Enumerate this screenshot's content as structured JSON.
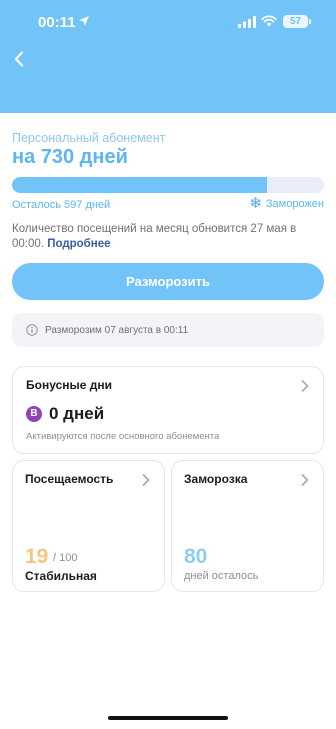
{
  "colors": {
    "accent": "#72c3f7",
    "accent_text": "#5eb5f0",
    "link": "#3b5da6",
    "bonus_badge": "#8f44b4",
    "attendance_value": "#f3c681",
    "freeze_value": "#8fcdf3"
  },
  "status_bar": {
    "time": "00:11",
    "battery": "57"
  },
  "subscription": {
    "label": "Персональный абонемент",
    "title": "на 730 дней",
    "progress_fraction": 0.818,
    "remaining": "Осталось 597 дней",
    "frozen_label": "Заморожен",
    "notice": "Количество посещений на месяц обновится 27 мая в 00:00.",
    "notice_link": "Подробнее"
  },
  "actions": {
    "unfreeze_label": "Разморозить"
  },
  "info": {
    "text": "Разморозим 07 августа в 00:11"
  },
  "bonus": {
    "title": "Бонусные дни",
    "badge": "B",
    "value": "0 дней",
    "note": "Активируются после основного абонемента"
  },
  "attendance": {
    "title": "Посещаемость",
    "value": "19",
    "max": "/ 100",
    "status": "Стабильная"
  },
  "freeze": {
    "title": "Заморозка",
    "value": "80",
    "note": "дней осталось"
  },
  "icons": {
    "back": "chevron-left-icon",
    "location": "location-arrow-icon",
    "signal": "signal-icon",
    "wifi": "wifi-icon",
    "snowflake": "snowflake-icon",
    "info": "info-icon",
    "chevron": "chevron-right-icon"
  }
}
